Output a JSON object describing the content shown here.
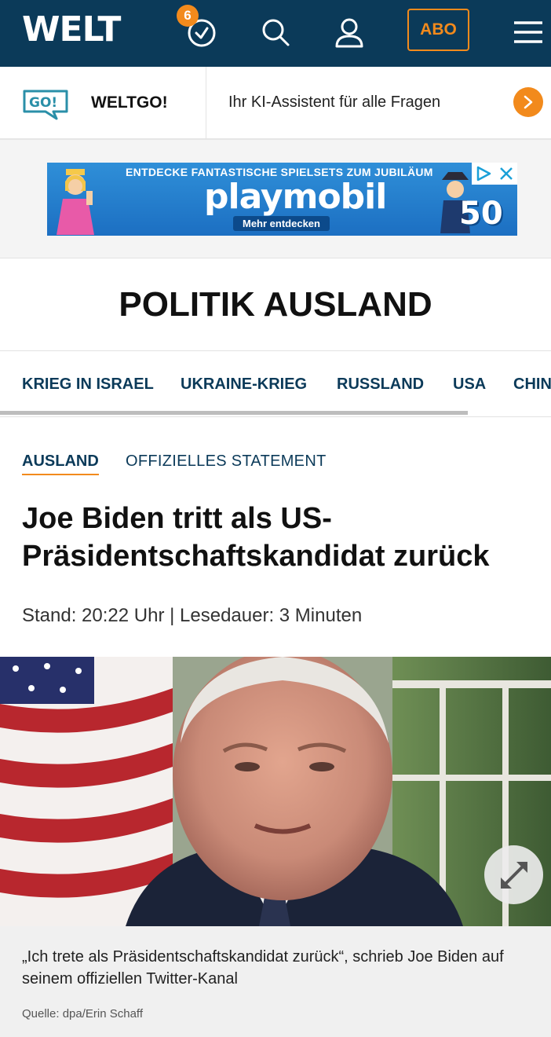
{
  "header": {
    "logo": "WELT",
    "history_badge": "6",
    "abo_label": "ABO"
  },
  "weltgo": {
    "badge": "GO!",
    "title": "WELTGO!",
    "tagline": "Ihr KI-Assistent für alle Fragen"
  },
  "ad": {
    "headline": "ENTDECKE FANTASTISCHE SPIELSETS ZUM JUBILÄUM",
    "brand": "playmobil",
    "cta": "Mehr entdecken",
    "anniversary": "50"
  },
  "section": {
    "title": "POLITIK AUSLAND"
  },
  "subnav": {
    "items": [
      "KRIEG IN ISRAEL",
      "UKRAINE-KRIEG",
      "RUSSLAND",
      "USA",
      "CHINA"
    ]
  },
  "article": {
    "kicker": "AUSLAND",
    "topic": "OFFIZIELLES STATEMENT",
    "headline": "Joe Biden tritt als US-Präsidentschaftskandidat zurück",
    "meta": "Stand: 20:22 Uhr | Lesedauer: 3 Minuten",
    "caption": "„Ich trete als Präsidentschaftskandidat zurück“, schrieb Joe Biden auf seinem offiziellen Twitter-Kanal",
    "source": "Quelle: dpa/Erin Schaff"
  },
  "colors": {
    "brand_navy": "#0b3a59",
    "accent_orange": "#f28a1c"
  }
}
